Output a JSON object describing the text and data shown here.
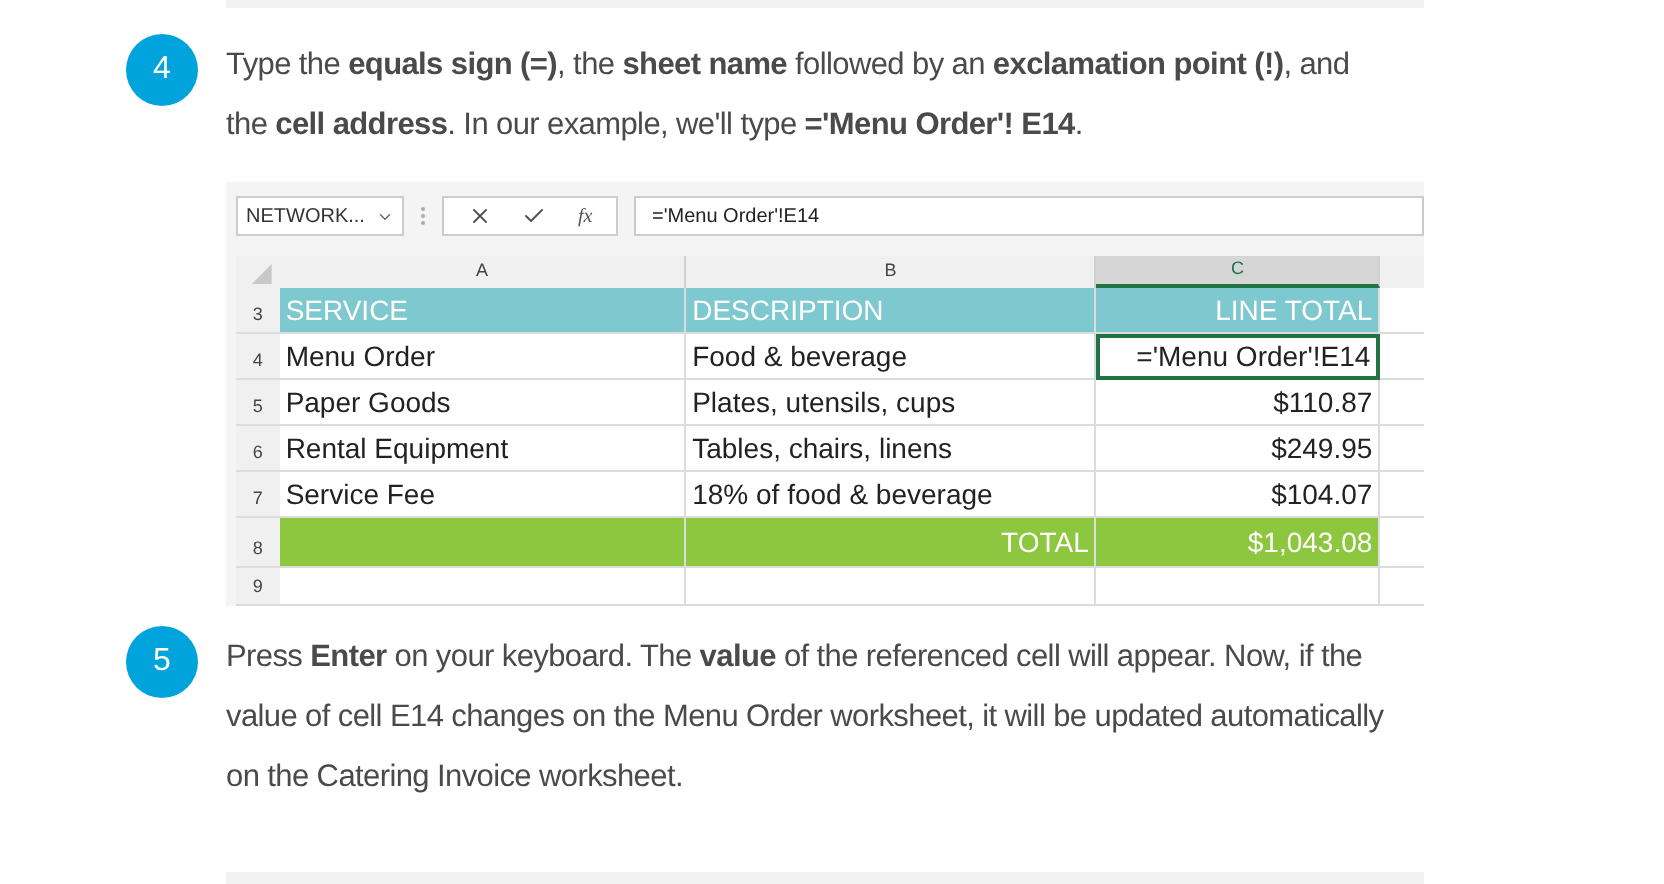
{
  "steps": [
    {
      "number": "4",
      "text": "Type the **equals sign (=)**, the **sheet name** followed by an **exclamation point (!)**, and the **cell address**. In our example, we'll type **='Menu Order'! E14**."
    },
    {
      "number": "5",
      "text": "Press **Enter** on your keyboard. The **value** of the referenced cell will appear. Now, if the value of cell E14 changes on the Menu Order worksheet, it will be updated automatically on the Catering Invoice worksheet."
    }
  ],
  "spreadsheet": {
    "name_box": "NETWORK...",
    "function_label": "fx",
    "formula": "='Menu Order'!E14",
    "columns": [
      {
        "label": "A",
        "selected": false
      },
      {
        "label": "B",
        "selected": false
      },
      {
        "label": "C",
        "selected": true
      }
    ],
    "rows": [
      {
        "number": "3",
        "kind": "header",
        "cells": [
          {
            "text": "SERVICE",
            "selected": false
          },
          {
            "text": "DESCRIPTION",
            "selected": false
          },
          {
            "text": "LINE TOTAL",
            "selected": false
          }
        ]
      },
      {
        "number": "4",
        "kind": "item",
        "cells": [
          {
            "text": "Menu Order",
            "selected": false
          },
          {
            "text": "Food & beverage",
            "selected": false
          },
          {
            "text": "='Menu Order'!E14",
            "selected": true
          }
        ]
      },
      {
        "number": "5",
        "kind": "item",
        "cells": [
          {
            "text": "Paper Goods",
            "selected": false
          },
          {
            "text": "Plates, utensils, cups",
            "selected": false
          },
          {
            "text": "$110.87",
            "selected": false
          }
        ]
      },
      {
        "number": "6",
        "kind": "item",
        "cells": [
          {
            "text": "Rental Equipment",
            "selected": false
          },
          {
            "text": "Tables, chairs, linens",
            "selected": false
          },
          {
            "text": "$249.95",
            "selected": false
          }
        ]
      },
      {
        "number": "7",
        "kind": "item",
        "cells": [
          {
            "text": "Service Fee",
            "selected": false
          },
          {
            "text": "18% of food & beverage",
            "selected": false
          },
          {
            "text": "$104.07",
            "selected": false
          }
        ]
      },
      {
        "number": "8",
        "kind": "total",
        "cells": [
          {
            "selected": false
          },
          {
            "text": "TOTAL",
            "selected": false
          },
          {
            "text": "$1,043.08",
            "selected": false
          }
        ]
      },
      {
        "number": "9",
        "kind": "empty",
        "cells": [
          {
            "selected": false
          },
          {
            "selected": false
          },
          {
            "selected": false
          }
        ]
      }
    ]
  }
}
